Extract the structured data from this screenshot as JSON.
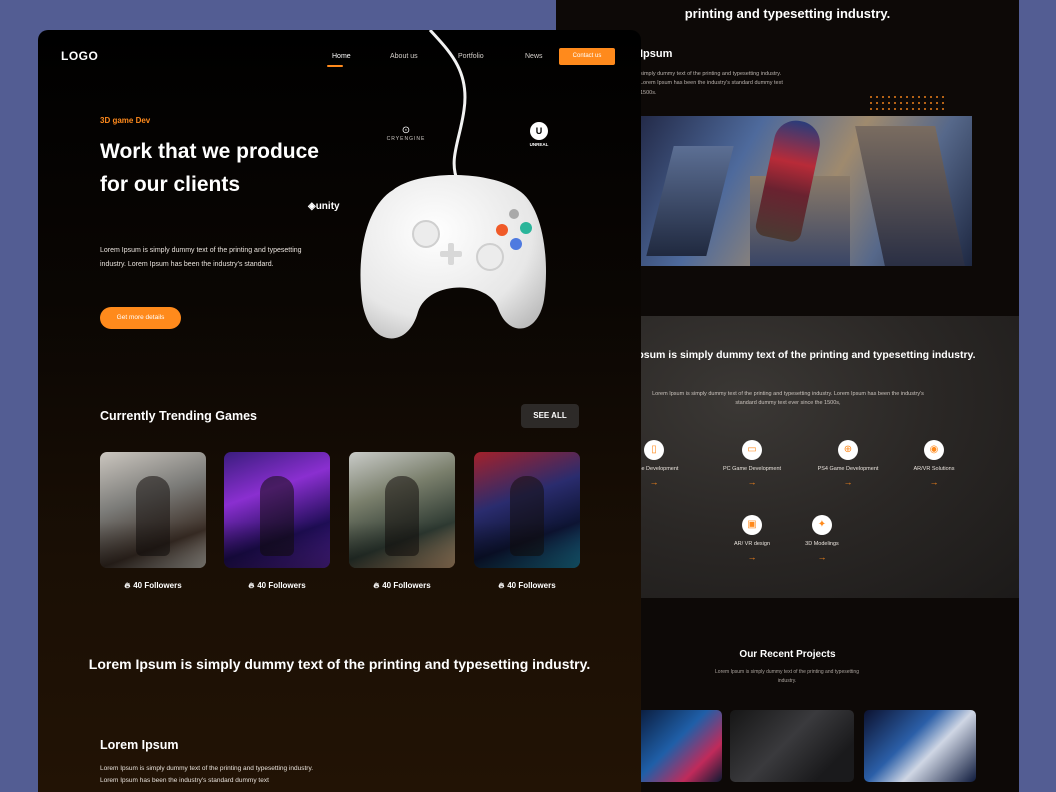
{
  "back": {
    "heading": "printing and typesetting industry.",
    "about_title": "Ipsum",
    "about_text": "simply dummy text of the printing and typesetting industry. Lorem Ipsum has been the industry's standard dummy text 1500s.",
    "services": {
      "title": "Lorem Ipsum is simply dummy text of the printing and typesetting industry.",
      "text": "Lorem Ipsum is simply dummy text of the printing and typesetting industry. Lorem Ipsum has been the industry's standard dummy text ever since the 1500s,",
      "items": [
        {
          "label": "Game Development",
          "icon": "mobile-icon"
        },
        {
          "label": "PC Game Development",
          "icon": "monitor-icon"
        },
        {
          "label": "PS4 Game Development",
          "icon": "gamepad-icon"
        },
        {
          "label": "AR/VR Solutions",
          "icon": "vr-headset-icon"
        },
        {
          "label": "AR/ VR design",
          "icon": "design-icon"
        },
        {
          "label": "3D Modelings",
          "icon": "cube-icon"
        }
      ],
      "arrow": "→"
    },
    "recent": {
      "title": "Our Recent Projects",
      "text": "Lorem Ipsum is simply dummy text of the printing and typesetting industry."
    }
  },
  "front": {
    "logo": "LOGO",
    "nav": {
      "home": "Home",
      "about": "About us",
      "portfolio": "Portfolio",
      "news": "News",
      "contact": "Contact us"
    },
    "eyebrow": "3D game Dev",
    "hero_title": "Work that we produce for our clients",
    "hero_text": "Lorem Ipsum is simply dummy text of the printing and typesetting industry. Lorem Ipsum has been the industry's standard.",
    "cta": "Get more details",
    "engines": {
      "cryengine": "CRYENGINE",
      "unreal": "UNREAL",
      "unity": "unity"
    },
    "trending": {
      "title": "Currently Trending Games",
      "see_all": "SEE ALL",
      "cards": [
        {
          "followers": "40 Followers"
        },
        {
          "followers": "40 Followers"
        },
        {
          "followers": "40 Followers"
        },
        {
          "followers": "40 Followers"
        }
      ]
    },
    "heading": "Lorem Ipsum is simply dummy text of the printing and typesetting industry.",
    "sub_title": "Lorem Ipsum",
    "sub_text": "Lorem Ipsum is simply dummy text of the printing and typesetting industry. Lorem Ipsum has been the industry's standard dummy text"
  },
  "colors": {
    "accent": "#ff8a1c",
    "background": "#535d93",
    "page": "#000000"
  }
}
